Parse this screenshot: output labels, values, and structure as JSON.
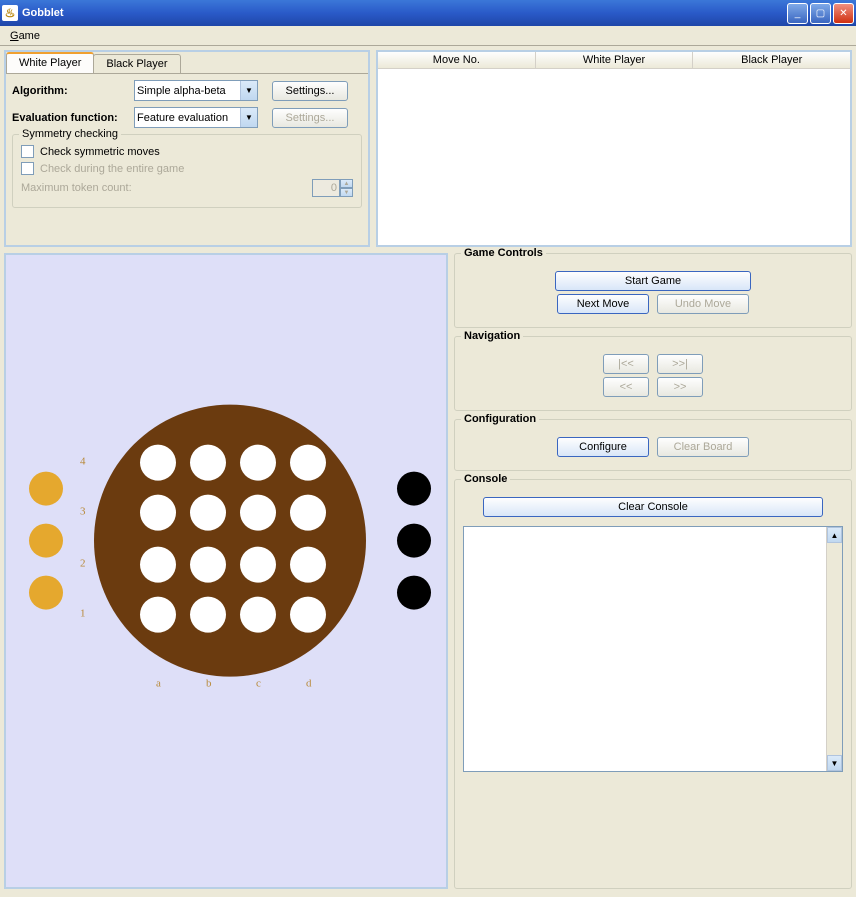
{
  "window": {
    "title": "Gobblet"
  },
  "menubar": {
    "game": "Game"
  },
  "tabs": {
    "white": "White Player",
    "black": "Black Player"
  },
  "config": {
    "algorithm_label": "Algorithm:",
    "algorithm_value": "Simple alpha-beta",
    "eval_label": "Evaluation function:",
    "eval_value": "Feature evaluation",
    "settings_label": "Settings...",
    "symmetry_legend": "Symmetry checking",
    "check_symmetric": "Check symmetric moves",
    "check_entire": "Check during the entire game",
    "max_token_label": "Maximum token count:",
    "max_token_value": "0"
  },
  "table": {
    "col_move": "Move No.",
    "col_white": "White Player",
    "col_black": "Black Player"
  },
  "controls": {
    "game_legend": "Game Controls",
    "start": "Start Game",
    "next": "Next Move",
    "undo": "Undo Move",
    "nav_legend": "Navigation",
    "nav_first": "|<<",
    "nav_last": ">>|",
    "nav_prev": "<<",
    "nav_next": ">>",
    "config_legend": "Configuration",
    "configure": "Configure",
    "clear_board": "Clear Board",
    "console_legend": "Console",
    "clear_console": "Clear Console"
  },
  "board": {
    "rows": [
      "4",
      "3",
      "2",
      "1"
    ],
    "cols": [
      "a",
      "b",
      "c",
      "d"
    ]
  }
}
